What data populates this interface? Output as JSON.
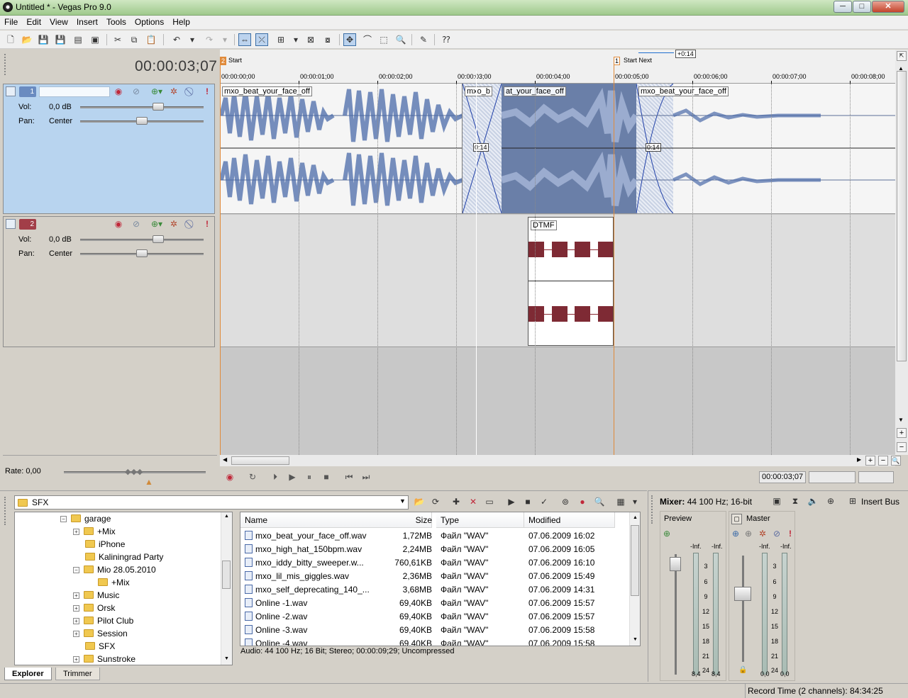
{
  "window": {
    "title": "Untitled * - Vegas Pro 9.0",
    "controls": {
      "minimize": "─",
      "maximize": "□",
      "close": "✕"
    }
  },
  "menu": [
    "File",
    "Edit",
    "View",
    "Insert",
    "Tools",
    "Options",
    "Help"
  ],
  "current_time": "00:00:03;07",
  "markers": {
    "start": {
      "number": "2",
      "label": "Start"
    },
    "start_next": {
      "number": "1",
      "label": "Start Next"
    },
    "next_offset": "+0:14"
  },
  "ruler": {
    "labels": [
      "00:00:00;00",
      "00:00:01;00",
      "00:00:02;00",
      "00:00:03;00",
      "00:00:04;00",
      "00:00:05;00",
      "00:00:06;00",
      "00:00:07;00",
      "00:00:08;00"
    ]
  },
  "tracks": [
    {
      "number": "1",
      "vol_label": "Vol:",
      "vol_value": "0,0 dB",
      "pan_label": "Pan:",
      "pan_value": "Center",
      "color": "#6a8bc0"
    },
    {
      "number": "2",
      "vol_label": "Vol:",
      "vol_value": "0,0 dB",
      "pan_label": "Pan:",
      "pan_value": "Center",
      "color": "#a23e48"
    }
  ],
  "events": {
    "clip1": "mxo_beat_your_face_off",
    "clip2a": "mxo_b",
    "clip2b": "at_your_face_off",
    "clip3": "mxo_beat_your_face_off",
    "fade1": "0:14",
    "fade2": "0:14",
    "dtmf": "DTMF"
  },
  "rate": {
    "label": "Rate: 0,00"
  },
  "transport": {
    "time": "00:00:03;07"
  },
  "explorer": {
    "path": "SFX",
    "tree": [
      {
        "label": "garage",
        "level": 0,
        "expander": "−"
      },
      {
        "label": "+Mix",
        "level": 1,
        "expander": "+"
      },
      {
        "label": "iPhone",
        "level": 1,
        "expander": ""
      },
      {
        "label": "Kaliningrad Party",
        "level": 1,
        "expander": ""
      },
      {
        "label": "Mio 28.05.2010",
        "level": 1,
        "expander": "−"
      },
      {
        "label": "+Mix",
        "level": 2,
        "expander": ""
      },
      {
        "label": "Music",
        "level": 1,
        "expander": "+"
      },
      {
        "label": "Orsk",
        "level": 1,
        "expander": "+"
      },
      {
        "label": "Pilot Club",
        "level": 1,
        "expander": "+"
      },
      {
        "label": "Session",
        "level": 1,
        "expander": "+"
      },
      {
        "label": "SFX",
        "level": 1,
        "expander": ""
      },
      {
        "label": "Sunstroke",
        "level": 1,
        "expander": "+"
      }
    ],
    "columns": {
      "name": "Name",
      "size": "Size",
      "type": "Type",
      "modified": "Modified"
    },
    "files": [
      {
        "name": "mxo_beat_your_face_off.wav",
        "size": "1,72MB",
        "type": "Файл \"WAV\"",
        "modified": "07.06.2009 16:02"
      },
      {
        "name": "mxo_high_hat_150bpm.wav",
        "size": "2,24MB",
        "type": "Файл \"WAV\"",
        "modified": "07.06.2009 16:05"
      },
      {
        "name": "mxo_iddy_bitty_sweeper.w...",
        "size": "760,61KB",
        "type": "Файл \"WAV\"",
        "modified": "07.06.2009 16:10"
      },
      {
        "name": "mxo_lil_mis_giggles.wav",
        "size": "2,36MB",
        "type": "Файл \"WAV\"",
        "modified": "07.06.2009 15:49"
      },
      {
        "name": "mxo_self_deprecating_140_...",
        "size": "3,68MB",
        "type": "Файл \"WAV\"",
        "modified": "07.06.2009 14:31"
      },
      {
        "name": "Online -1.wav",
        "size": "69,40KB",
        "type": "Файл \"WAV\"",
        "modified": "07.06.2009 15:57"
      },
      {
        "name": "Online -2.wav",
        "size": "69,40KB",
        "type": "Файл \"WAV\"",
        "modified": "07.06.2009 15:57"
      },
      {
        "name": "Online -3.wav",
        "size": "69,40KB",
        "type": "Файл \"WAV\"",
        "modified": "07.06.2009 15:58"
      },
      {
        "name": "Online -4.wav",
        "size": "69,40KB",
        "type": "Файл \"WAV\"",
        "modified": "07.06.2009 15:58"
      }
    ],
    "status": "Audio: 44 100 Hz; 16 Bit; Stereo; 00:00:09;29; Uncompressed",
    "tabs": [
      "Explorer",
      "Trimmer"
    ]
  },
  "mixer": {
    "title_bold": "Mixer:",
    "title_rest": "44 100 Hz; 16-bit",
    "insert_bus": "Insert Bus",
    "preview": "Preview",
    "master": "Master",
    "inf": "-Inf.",
    "scale": [
      "3",
      "6",
      "9",
      "12",
      "15",
      "18",
      "21",
      "24"
    ],
    "preview_peak": [
      "8,4",
      "8,4"
    ],
    "master_peak": [
      "0,0",
      "0,0"
    ]
  },
  "status": {
    "record_time": "Record Time (2 channels): 84:34:25"
  }
}
